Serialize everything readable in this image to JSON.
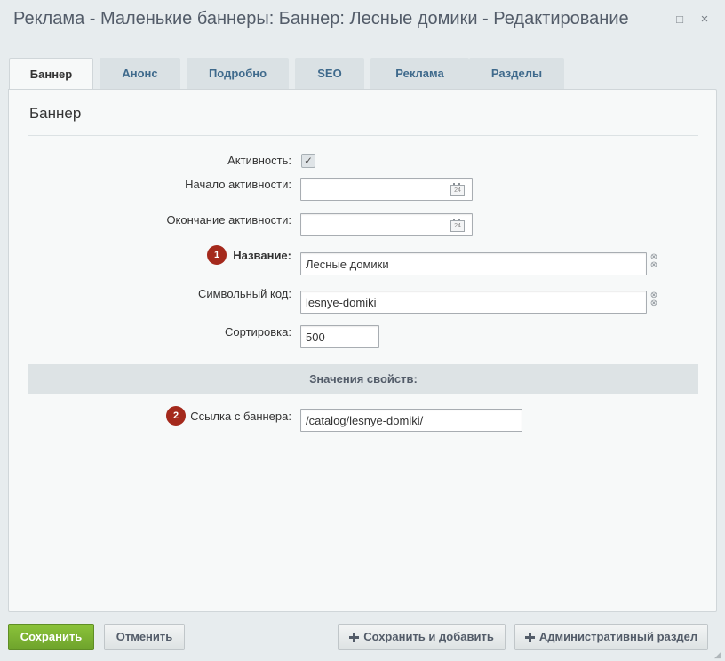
{
  "window": {
    "title": "Реклама - Маленькие баннеры: Баннер: Лесные домики - Редактирование",
    "maximize_icon": "□",
    "close_icon": "×"
  },
  "tabs": [
    {
      "label": "Баннер",
      "active": true
    },
    {
      "label": "Анонс"
    },
    {
      "label": "Подробно"
    },
    {
      "label": "SEO"
    },
    {
      "label": "Реклама"
    },
    {
      "label": "Разделы"
    }
  ],
  "panel": {
    "title": "Баннер",
    "fields": {
      "active": {
        "label": "Активность:",
        "checked": true
      },
      "start": {
        "label": "Начало активности:",
        "value": ""
      },
      "end": {
        "label": "Окончание активности:",
        "value": ""
      },
      "name": {
        "label": "Название:",
        "value": "Лесные домики",
        "badge": "1"
      },
      "code": {
        "label": "Символьный код:",
        "value": "lesnye-domiki"
      },
      "sort": {
        "label": "Сортировка:",
        "value": "500"
      }
    },
    "properties_header": "Значения свойств:",
    "banner_link": {
      "label": "Ссылка с баннера:",
      "value": "/catalog/lesnye-domiki/",
      "badge": "2"
    },
    "calendar_icon_text": "24"
  },
  "footer": {
    "save": "Сохранить",
    "cancel": "Отменить",
    "save_add": "Сохранить и добавить",
    "admin_section": "Административный раздел"
  },
  "colors": {
    "accent_green": "#7ab234",
    "badge_red": "#a4291c",
    "tab_link": "#3f6a8c"
  }
}
